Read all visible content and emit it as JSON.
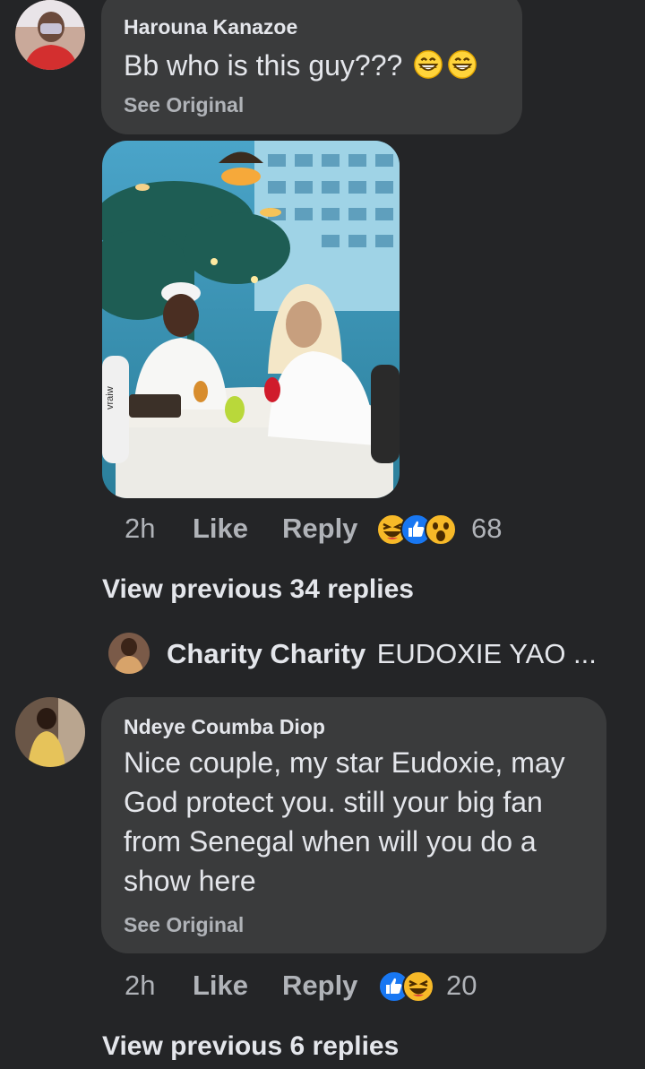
{
  "comment1": {
    "author": "Harouna Kanazoe",
    "text": "Bb who is this guy???",
    "emojis": [
      "grinning-face-icon",
      "grinning-face-icon"
    ],
    "see_original": "See Original",
    "time": "2h",
    "like_label": "Like",
    "reply_label": "Reply",
    "reactions": [
      "haha-icon",
      "like-icon",
      "wow-icon"
    ],
    "reaction_count": "68",
    "photo_overlay_text": "vraiw"
  },
  "view_prev_1": "View previous 34 replies",
  "reply_preview": {
    "author": "Charity Charity",
    "snippet": "EUDOXIE YAO ..."
  },
  "comment2": {
    "author": "Ndeye Coumba Diop",
    "text_lines": [
      "Nice couple, my star Eudoxie, may",
      "God protect you. still your big fan",
      "from Senegal when will you do a",
      "show here"
    ],
    "see_original": "See Original",
    "time": "2h",
    "like_label": "Like",
    "reply_label": "Reply",
    "reactions": [
      "like-icon",
      "haha-icon"
    ],
    "reaction_count": "20"
  },
  "view_prev_2": "View previous 6 replies",
  "colors": {
    "background": "#242527",
    "bubble": "#3a3b3c",
    "like_blue": "#1877f2",
    "haha_yellow": "#f7b928"
  }
}
